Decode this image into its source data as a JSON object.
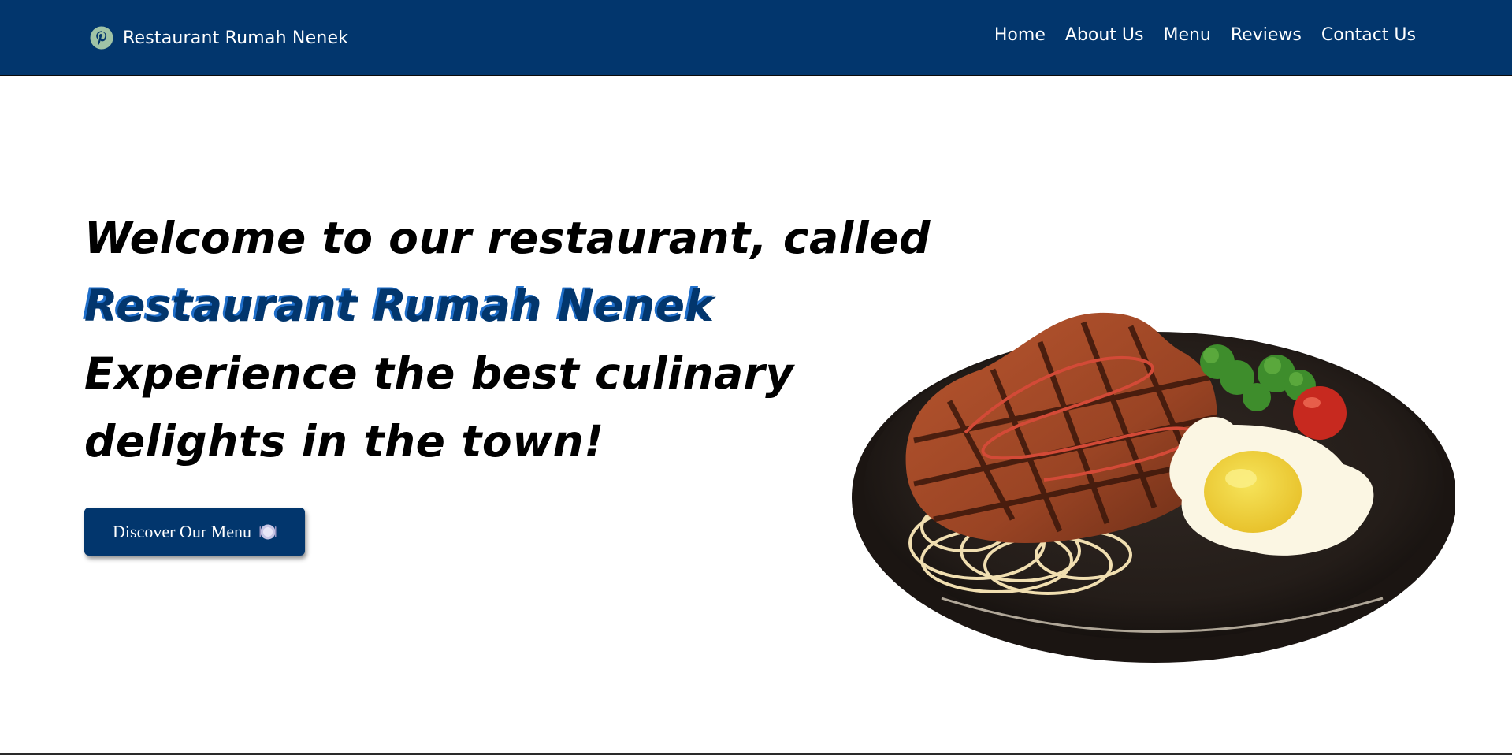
{
  "brand": {
    "name": "Restaurant Rumah Nenek",
    "icon": "pinterest-logo-icon",
    "icon_color": "#9fc3a6"
  },
  "nav": {
    "items": [
      {
        "label": "Home"
      },
      {
        "label": "About Us"
      },
      {
        "label": "Menu"
      },
      {
        "label": "Reviews"
      },
      {
        "label": "Contact Us"
      }
    ]
  },
  "hero": {
    "line1": "Welcome to our restaurant, called",
    "line2": "Restaurant Rumah Nenek",
    "line3": "Experience the best culinary",
    "line4": "delights in the town!",
    "cta_label": "Discover Our Menu",
    "cta_icon": "plate-icon",
    "image": "steak-plate-illustration"
  },
  "colors": {
    "navbar": "#02366d",
    "accent": "#02366d",
    "accent_shadow": "#1f6ec9",
    "text": "#000000",
    "background": "#ffffff"
  }
}
